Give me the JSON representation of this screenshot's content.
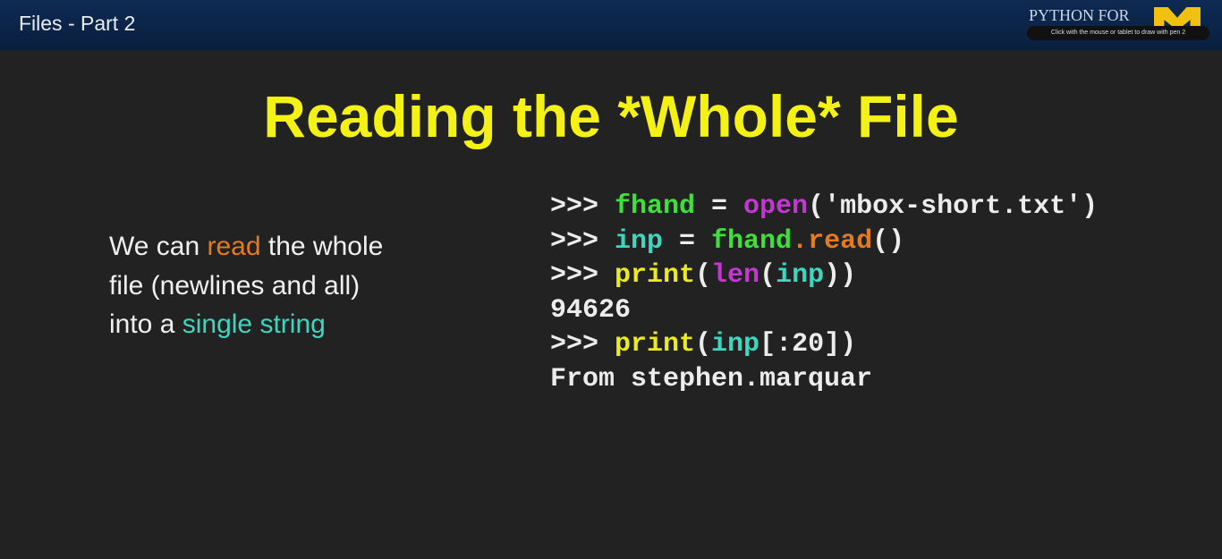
{
  "header": {
    "title": "Files - Part 2",
    "brand": "PYTHON FOR",
    "tooltip": "Click with the mouse or tablet to draw with pen 2",
    "logo_color": "#f2c10f"
  },
  "slide": {
    "title": "Reading the *Whole* File",
    "left_text": {
      "p1": "We can ",
      "read": "read",
      "p2": " the whole",
      "line2": "file (newlines and all)",
      "p3": "into a ",
      "single_string": "single string"
    },
    "code_lines": [
      [
        {
          "t": ">>> ",
          "c": "#ececec"
        },
        {
          "t": "fhand",
          "c": "#3ee03a"
        },
        {
          "t": " = ",
          "c": "#ececec"
        },
        {
          "t": "open",
          "c": "#c238d0"
        },
        {
          "t": "('mbox-short.txt')",
          "c": "#ececec"
        }
      ],
      [
        {
          "t": ">>> ",
          "c": "#ececec"
        },
        {
          "t": "inp",
          "c": "#3fd6c0"
        },
        {
          "t": " = ",
          "c": "#ececec"
        },
        {
          "t": "fhand",
          "c": "#3ee03a"
        },
        {
          "t": ".read",
          "c": "#e67a1c"
        },
        {
          "t": "()",
          "c": "#ececec"
        }
      ],
      [
        {
          "t": ">>> ",
          "c": "#ececec"
        },
        {
          "t": "print",
          "c": "#eaea1e"
        },
        {
          "t": "(",
          "c": "#ececec"
        },
        {
          "t": "len",
          "c": "#c238d0"
        },
        {
          "t": "(",
          "c": "#ececec"
        },
        {
          "t": "inp",
          "c": "#3fd6c0"
        },
        {
          "t": "))",
          "c": "#ececec"
        }
      ],
      [
        {
          "t": "94626",
          "c": "#ececec"
        }
      ],
      [
        {
          "t": ">>> ",
          "c": "#ececec"
        },
        {
          "t": "print",
          "c": "#eaea1e"
        },
        {
          "t": "(",
          "c": "#ececec"
        },
        {
          "t": "inp",
          "c": "#3fd6c0"
        },
        {
          "t": "[:20])",
          "c": "#ececec"
        }
      ],
      [
        {
          "t": "From stephen.marquar",
          "c": "#ececec"
        }
      ]
    ]
  }
}
